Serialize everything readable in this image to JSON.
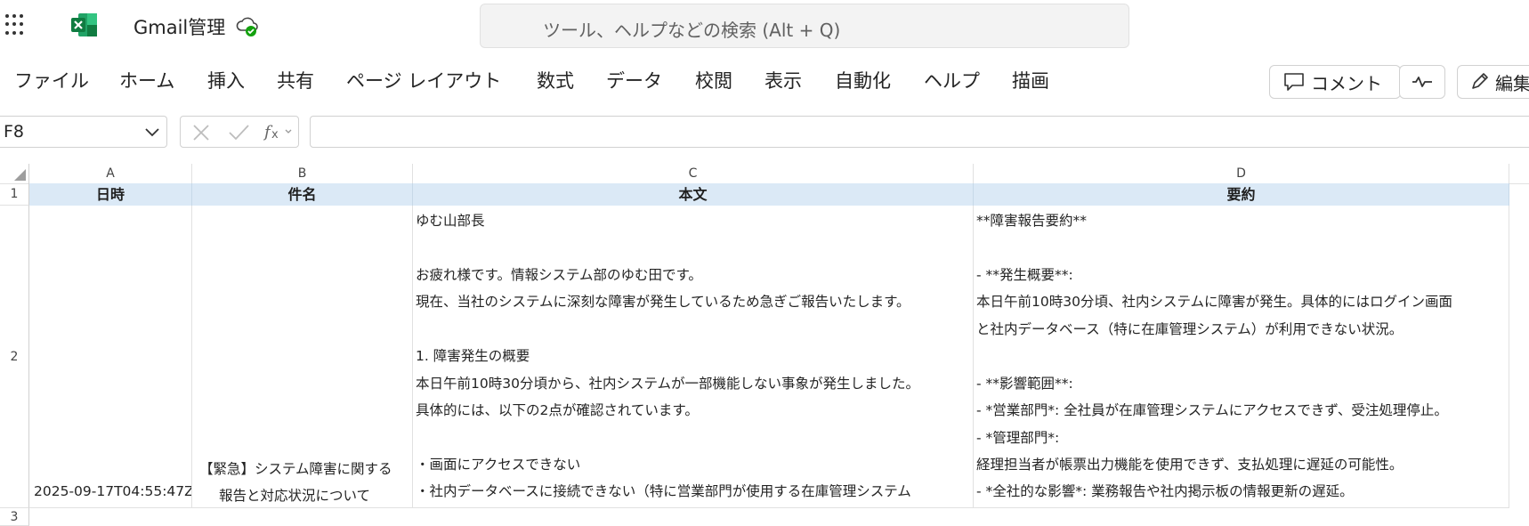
{
  "app": {
    "title": "Gmail管理"
  },
  "search": {
    "placeholder": "ツール、ヘルプなどの検索 (Alt + Q)"
  },
  "ribbon": {
    "tabs": [
      "ファイル",
      "ホーム",
      "挿入",
      "共有",
      "ページ レイアウト",
      "数式",
      "データ",
      "校閲",
      "表示",
      "自動化",
      "ヘルプ",
      "描画"
    ],
    "comment_label": "コメント",
    "edit_label": "編集"
  },
  "formula_bar": {
    "name_box": "F8",
    "formula": ""
  },
  "columns": [
    "A",
    "B",
    "C",
    "D"
  ],
  "rows": [
    "1",
    "2",
    "3"
  ],
  "headers": {
    "a": "日時",
    "b": "件名",
    "c": "本文",
    "d": "要約"
  },
  "row2": {
    "datetime": "2025-09-17T04:55:47Z",
    "subject_lines": [
      "【緊急】システム障害に関する",
      "報告と対応状況について"
    ],
    "body_lines": [
      "ゆむ山部長",
      "",
      "お疲れ様です。情報システム部のゆむ田です。",
      "現在、当社のシステムに深刻な障害が発生しているため急ぎご報告いたします。",
      "",
      "1. 障害発生の概要",
      "本日午前10時30分頃から、社内システムが一部機能しない事象が発生しました。",
      "具体的には、以下の2点が確認されています。",
      "",
      "・画面にアクセスできない",
      "・社内データベースに接続できない（特に営業部門が使用する在庫管理システム"
    ],
    "summary_lines": [
      "**障害報告要約**",
      "",
      "- **発生概要**:",
      "本日午前10時30分頃、社内システムに障害が発生。具体的にはログイン画面",
      "と社内データベース（特に在庫管理システム）が利用できない状況。",
      "",
      "- **影響範囲**:",
      "  - *営業部門*: 全社員が在庫管理システムにアクセスできず、受注処理停止。",
      "  - *管理部門*:",
      "経理担当者が帳票出力機能を使用できず、支払処理に遅延の可能性。",
      "  - *全社的な影響*: 業務報告や社内掲示板の情報更新の遅延。"
    ]
  },
  "colors": {
    "header_fill": "#dbe9f6",
    "excel_green": "#107c41",
    "sync_green": "#13a10e"
  },
  "icons": [
    "app-launcher-icon",
    "excel-logo-icon",
    "cloud-sync-icon",
    "comment-icon",
    "pen-icon",
    "chevron-down-icon",
    "cancel-icon",
    "check-icon",
    "fx-icon"
  ]
}
